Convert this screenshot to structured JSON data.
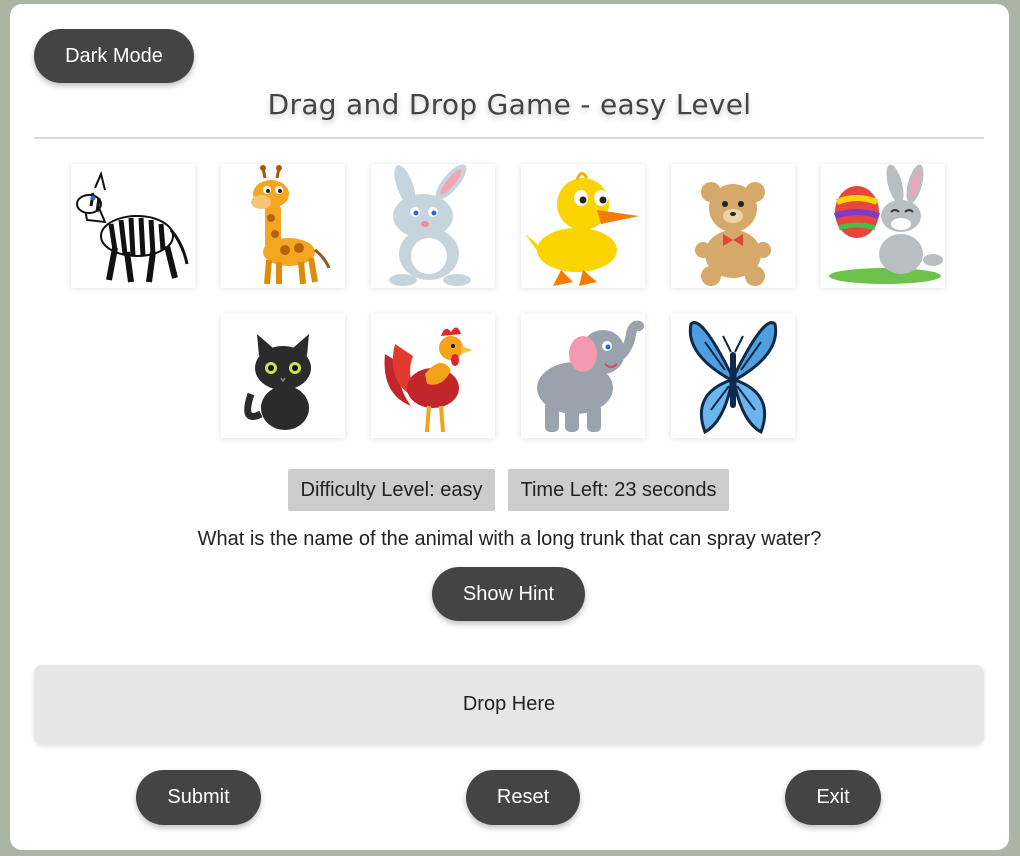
{
  "header": {
    "dark_mode_label": "Dark Mode",
    "title": "Drag and Drop Game - easy Level"
  },
  "animals": [
    {
      "icon": "zebra-icon"
    },
    {
      "icon": "giraffe-icon"
    },
    {
      "icon": "rabbit-icon"
    },
    {
      "icon": "duck-icon"
    },
    {
      "icon": "teddy-bear-icon"
    },
    {
      "icon": "easter-bunny-icon"
    },
    {
      "icon": "cat-icon"
    },
    {
      "icon": "rooster-icon"
    },
    {
      "icon": "elephant-icon"
    },
    {
      "icon": "butterfly-icon"
    }
  ],
  "status": {
    "difficulty": "Difficulty Level: easy",
    "time_left": "Time Left: 23 seconds"
  },
  "question": "What is the name of the animal with a long trunk that can spray water?",
  "hint_label": "Show Hint",
  "drop_zone_label": "Drop Here",
  "actions": {
    "submit": "Submit",
    "reset": "Reset",
    "exit": "Exit"
  },
  "colors": {
    "page_background": "#aab5a4",
    "button": "#444444",
    "badge": "#cccccc",
    "drop_zone": "#e6e6e6"
  }
}
